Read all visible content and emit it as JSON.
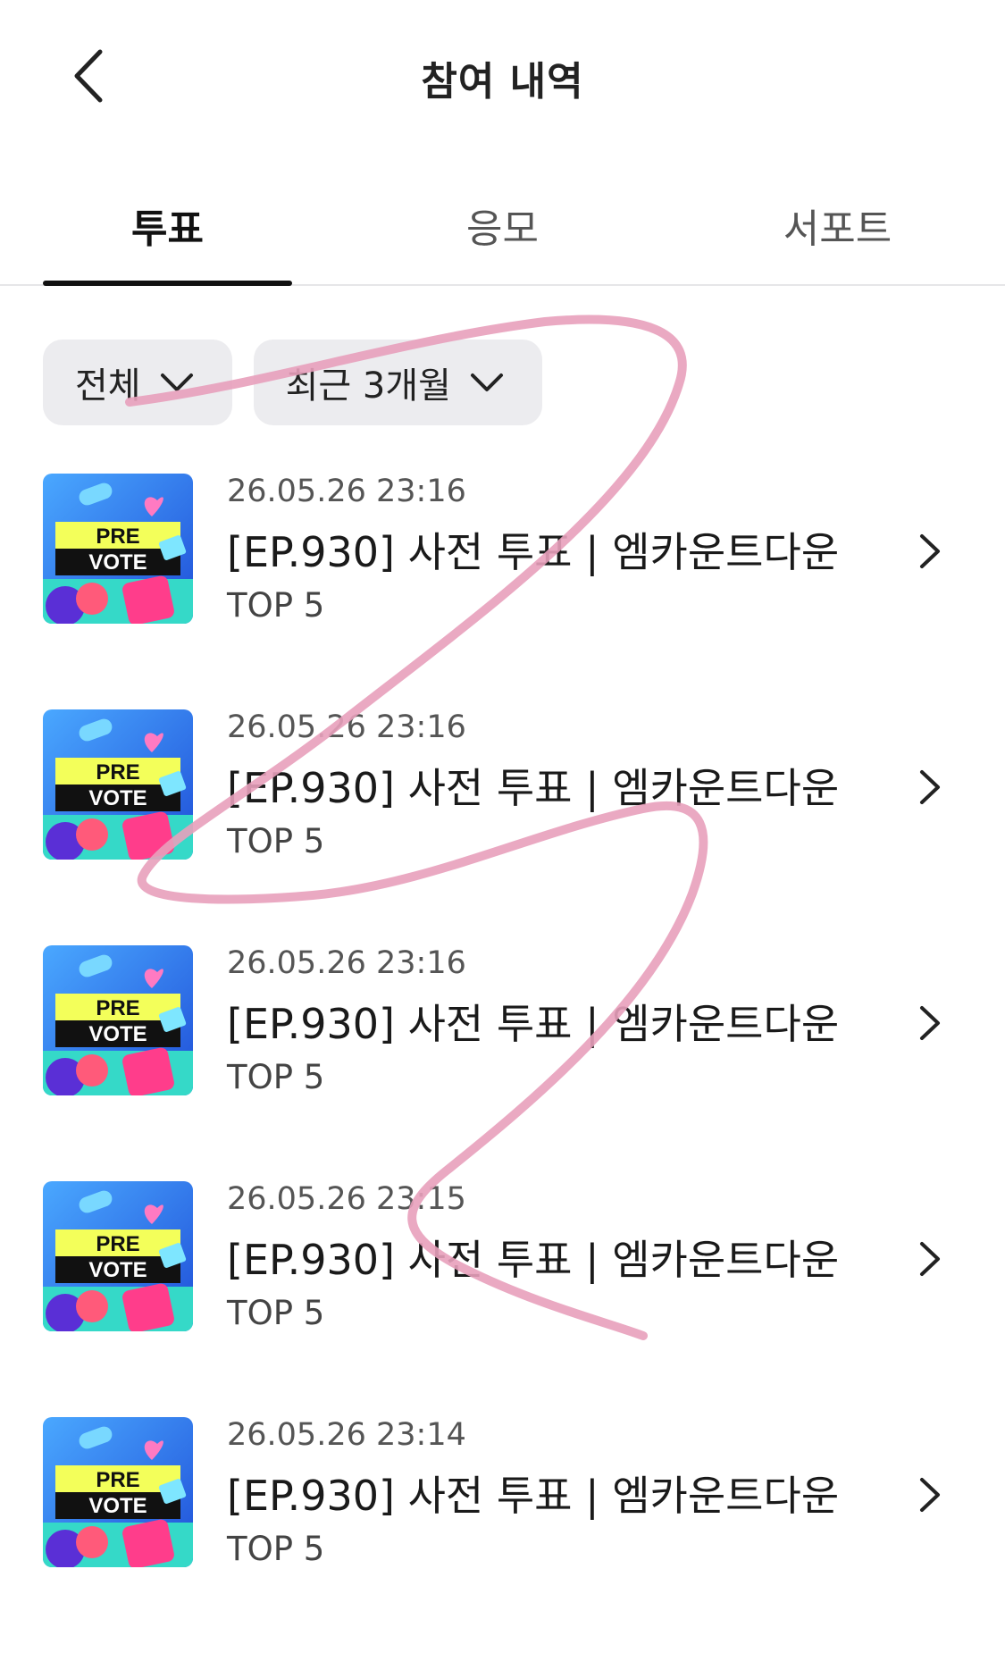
{
  "header": {
    "title": "참여 내역",
    "back_icon": "chevron-left-icon"
  },
  "tabs": [
    {
      "label": "투표",
      "active": true
    },
    {
      "label": "응모",
      "active": false
    },
    {
      "label": "서포트",
      "active": false
    }
  ],
  "filters": [
    {
      "label": "전체",
      "icon": "chevron-down-icon"
    },
    {
      "label": "최근 3개월",
      "icon": "chevron-down-icon"
    }
  ],
  "items": [
    {
      "date": "26.05.26 23:16",
      "title": "[EP.930] 사전 투표 | 엠카운트다운",
      "sub": "TOP 5",
      "thumb_text": [
        "PRE",
        "VOTE"
      ]
    },
    {
      "date": "26.05.26 23:16",
      "title": "[EP.930] 사전 투표 | 엠카운트다운",
      "sub": "TOP 5",
      "thumb_text": [
        "PRE",
        "VOTE"
      ]
    },
    {
      "date": "26.05.26 23:16",
      "title": "[EP.930] 사전 투표 | 엠카운트다운",
      "sub": "TOP 5",
      "thumb_text": [
        "PRE",
        "VOTE"
      ]
    },
    {
      "date": "26.05.26 23:15",
      "title": "[EP.930] 사전 투표 | 엠카운트다운",
      "sub": "TOP 5",
      "thumb_text": [
        "PRE",
        "VOTE"
      ]
    },
    {
      "date": "26.05.26 23:14",
      "title": "[EP.930] 사전 투표 | 엠카운트다운",
      "sub": "TOP 5",
      "thumb_text": [
        "PRE",
        "VOTE"
      ]
    }
  ],
  "colors": {
    "chip_bg": "#ececef",
    "indicator": "#111111",
    "scribble": "#e8a0bb",
    "thumb_bg": "#2b6bff",
    "thumb_band_yellow": "#f3ff5a"
  }
}
